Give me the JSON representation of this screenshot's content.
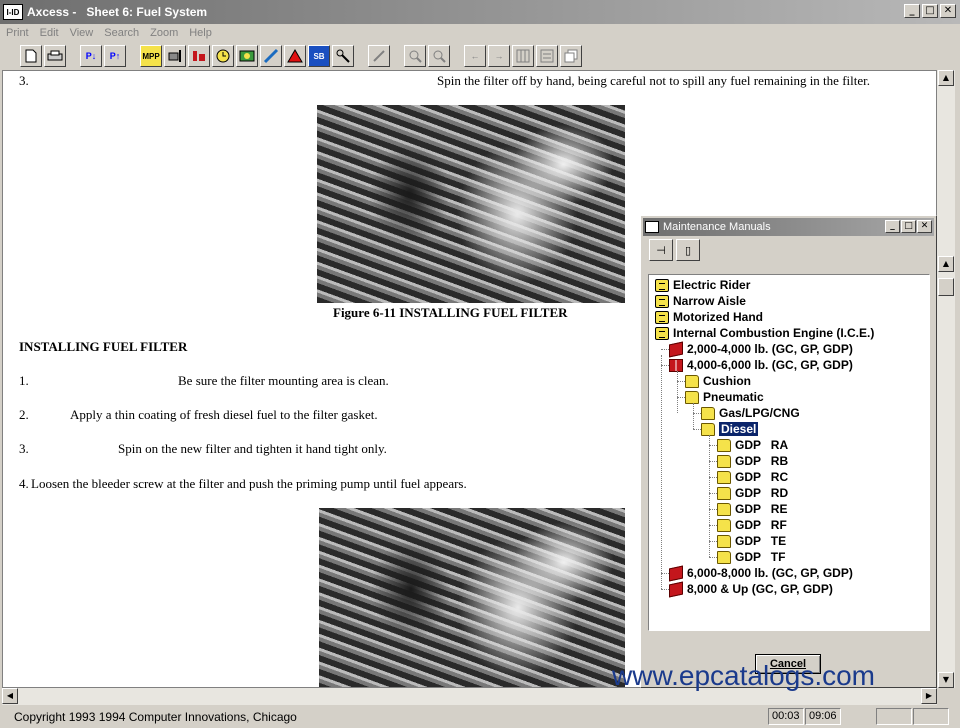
{
  "window": {
    "logo_text": "I-ID",
    "title": "Axcess -   Sheet 6: Fuel System",
    "min": "_",
    "max": "□",
    "close": "✕"
  },
  "menu": [
    "Print",
    "Edit",
    "View",
    "Search",
    "Zoom",
    "Help"
  ],
  "toolbar": {
    "groups": [
      [
        "",
        ""
      ],
      [
        "P↓",
        "P↑"
      ],
      [
        "MPP",
        "",
        "",
        "",
        "",
        "",
        "",
        "SB",
        ""
      ],
      [
        ""
      ],
      [
        "",
        ""
      ],
      [
        "←",
        "→",
        "",
        "",
        ""
      ]
    ]
  },
  "document": {
    "step3_num": "3.",
    "step3_text": "Spin the filter off by hand, being careful not to spill any fuel remaining in the filter.",
    "figure_caption": "Figure 6-11 INSTALLING FUEL FILTER",
    "heading": "INSTALLING FUEL FILTER",
    "steps": [
      {
        "num": "1.",
        "text": "Be sure the filter mounting area is clean."
      },
      {
        "num": "2.",
        "text": "Apply a thin coating of fresh diesel fuel to the filter gasket."
      },
      {
        "num": "3.",
        "text": "Spin on the new filter and tighten it hand tight only."
      },
      {
        "num": "4.",
        "text": "Loosen the bleeder screw at the filter and push the priming pump until fuel appears."
      }
    ]
  },
  "dialog": {
    "title": "Maintenance Manuals",
    "tool_pin": "⊣",
    "tool_page": "▯",
    "tree": [
      {
        "label": "Electric Rider",
        "icon": "doc",
        "level": 0
      },
      {
        "label": "Narrow Aisle",
        "icon": "doc",
        "level": 0
      },
      {
        "label": "Motorized Hand",
        "icon": "doc",
        "level": 0
      },
      {
        "label": "Internal Combustion Engine (I.C.E.)",
        "icon": "doc",
        "level": 0
      },
      {
        "label": "2,000-4,000 lb. (GC, GP, GDP)",
        "icon": "book",
        "level": 1
      },
      {
        "label": "4,000-6,000 lb. (GC, GP, GDP)",
        "icon": "openbook",
        "level": 1
      },
      {
        "label": "Cushion",
        "icon": "folder",
        "level": 2
      },
      {
        "label": "Pneumatic",
        "icon": "folder",
        "level": 2
      },
      {
        "label": "Gas/LPG/CNG",
        "icon": "folder",
        "level": 3
      },
      {
        "label": "Diesel",
        "icon": "folder",
        "level": 3,
        "selected": true
      },
      {
        "label": "GDP   RA",
        "icon": "folder",
        "level": 4
      },
      {
        "label": "GDP   RB",
        "icon": "folder",
        "level": 4
      },
      {
        "label": "GDP   RC",
        "icon": "folder",
        "level": 4
      },
      {
        "label": "GDP   RD",
        "icon": "folder",
        "level": 4
      },
      {
        "label": "GDP   RE",
        "icon": "folder",
        "level": 4
      },
      {
        "label": "GDP   RF",
        "icon": "folder",
        "level": 4
      },
      {
        "label": "GDP   TE",
        "icon": "folder",
        "level": 4
      },
      {
        "label": "GDP   TF",
        "icon": "folder",
        "level": 4
      },
      {
        "label": "6,000-8,000 lb. (GC, GP, GDP)",
        "icon": "book",
        "level": 1
      },
      {
        "label": "8,000 & Up (GC, GP, GDP)",
        "icon": "book",
        "level": 1
      }
    ],
    "cancel_label": "Cancel"
  },
  "status": {
    "copyright": "Copyright 1993 1994 Computer Innovations, Chicago",
    "page": "00:03",
    "time": "09:06"
  },
  "watermark": "www.epcatalogs.com",
  "scroll": {
    "up": "▲",
    "down": "▼",
    "left": "◀",
    "right": "▶"
  }
}
